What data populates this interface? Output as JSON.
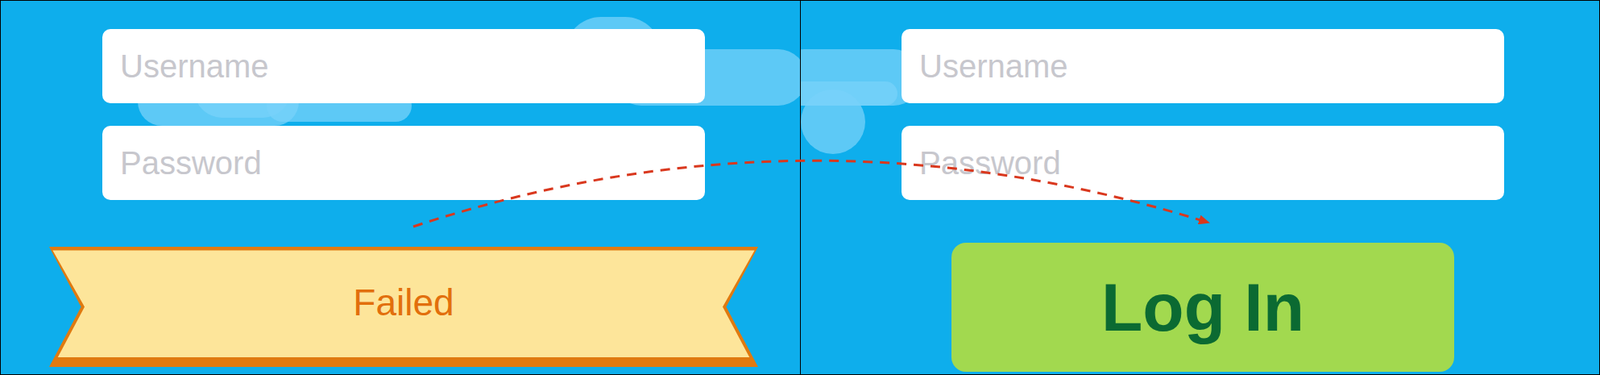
{
  "panels": [
    {
      "username": {
        "placeholder": "Username"
      },
      "password": {
        "placeholder": "Password"
      },
      "banner": {
        "label": "Failed"
      }
    },
    {
      "username": {
        "placeholder": "Username"
      },
      "password": {
        "placeholder": "Password"
      },
      "button": {
        "label": "Log In"
      }
    }
  ]
}
